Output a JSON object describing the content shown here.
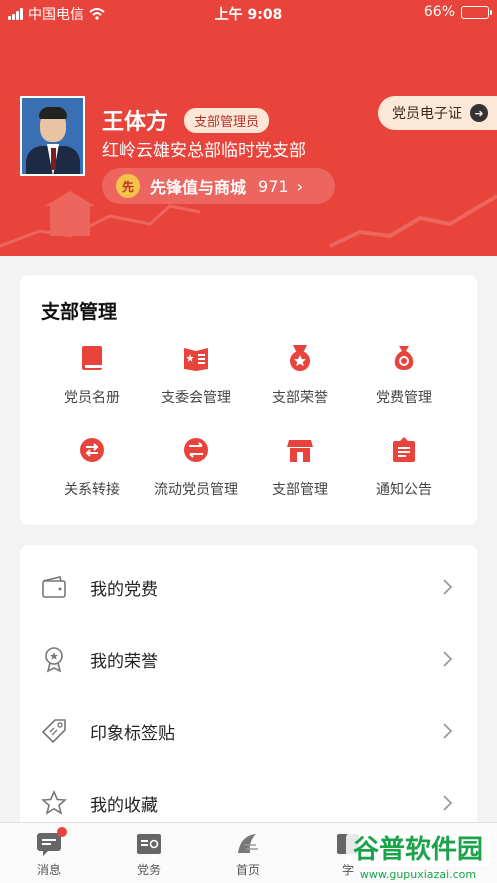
{
  "status_bar": {
    "carrier": "中国电信",
    "time": "上午 9:08",
    "battery": "66%",
    "battery_level": 0.66
  },
  "profile": {
    "name": "王体方",
    "role": "支部管理员",
    "org": "红岭云雄安总部临时党支部",
    "points_coin": "先",
    "points_label": "先锋值与商城",
    "points_value": "971",
    "points_arrow": "›",
    "ecard_label": "党员电子证",
    "ecard_arrow": "➜"
  },
  "branch": {
    "title": "支部管理",
    "items": [
      {
        "label": "党员名册",
        "icon": "book-icon"
      },
      {
        "label": "支委会管理",
        "icon": "committee-book-icon"
      },
      {
        "label": "支部荣誉",
        "icon": "medal-icon"
      },
      {
        "label": "党费管理",
        "icon": "money-bag-icon"
      },
      {
        "label": "关系转接",
        "icon": "transfer-icon"
      },
      {
        "label": "流动党员管理",
        "icon": "mobile-member-icon"
      },
      {
        "label": "支部管理",
        "icon": "store-icon"
      },
      {
        "label": "通知公告",
        "icon": "notice-icon"
      }
    ]
  },
  "list": [
    {
      "label": "我的党费",
      "icon": "wallet-icon"
    },
    {
      "label": "我的荣誉",
      "icon": "award-icon"
    },
    {
      "label": "印象标签贴",
      "icon": "tag-icon"
    },
    {
      "label": "我的收藏",
      "icon": "star-icon"
    }
  ],
  "tabs": [
    {
      "label": "消息",
      "icon": "message-icon",
      "badge": true
    },
    {
      "label": "党务",
      "icon": "party-affairs-icon"
    },
    {
      "label": "首页",
      "icon": "home-logo-icon"
    },
    {
      "label": "学",
      "icon": "study-icon"
    }
  ],
  "watermark": "谷普软件园",
  "watermark_url": "www.gupuxiazai.com",
  "colors": {
    "primary": "#e8443b",
    "badge_bg": "#fde7d6",
    "coin": "#f5c24a"
  }
}
